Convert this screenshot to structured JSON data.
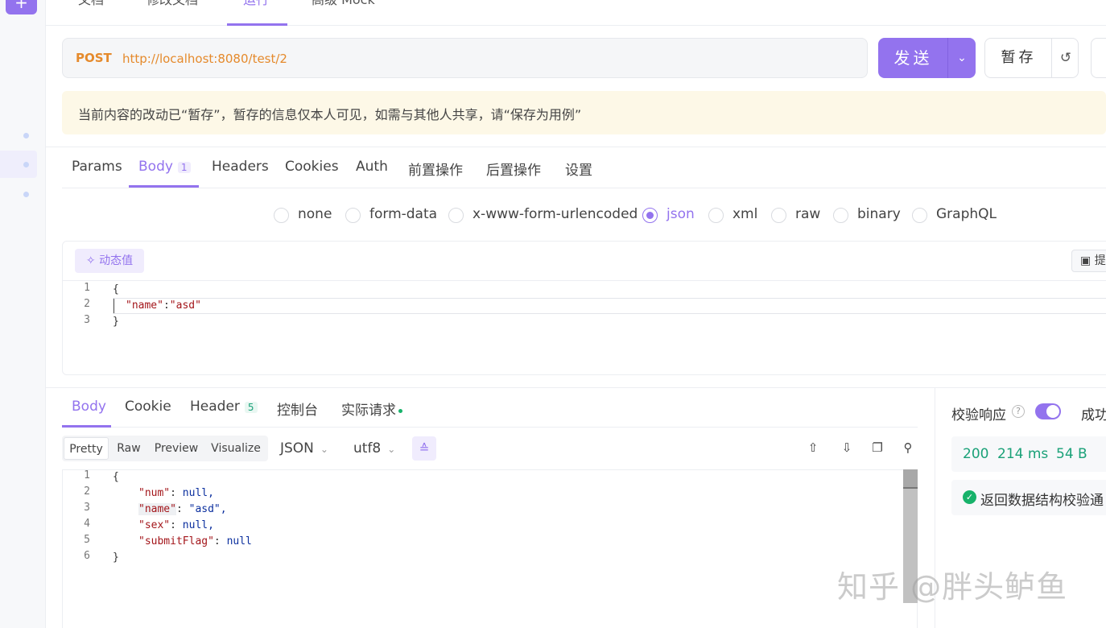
{
  "sidebar": {
    "add_icon": "plus-icon",
    "add_label": "+"
  },
  "top_tabs": [
    "文档",
    "修改文档",
    "运行",
    "高级 Mock"
  ],
  "request": {
    "method": "POST",
    "url": "http://localhost:8080/test/2",
    "send_label": "发送",
    "save_label": "暂存",
    "reset_icon": "reset-icon"
  },
  "notice": "当前内容的改动已“暂存”，暂存的信息仅本人可见，如需与其他人共享，请“保存为用例”",
  "request_tabs": {
    "params": "Params",
    "body": "Body",
    "body_badge": "1",
    "headers": "Headers",
    "cookies": "Cookies",
    "auth": "Auth",
    "pre": "前置操作",
    "post": "后置操作",
    "settings": "设置"
  },
  "body_types": [
    "none",
    "form-data",
    "x-www-form-urlencoded",
    "json",
    "xml",
    "raw",
    "binary",
    "GraphQL"
  ],
  "body_type_selected": "json",
  "editor": {
    "dynamic_label": "动态值",
    "extract_label": "提",
    "lines": [
      {
        "no": "1",
        "text": "{"
      },
      {
        "no": "2",
        "key": "\"name\"",
        "colon": ":",
        "value": "\"asd\""
      },
      {
        "no": "3",
        "text": "}"
      }
    ]
  },
  "response_tabs": {
    "body": "Body",
    "cookie": "Cookie",
    "header": "Header",
    "header_badge": "5",
    "console": "控制台",
    "actual": "实际请求"
  },
  "response_toolbar": {
    "formats": [
      "Pretty",
      "Raw",
      "Preview",
      "Visualize"
    ],
    "format_selected": "Pretty",
    "lang": "JSON",
    "encoding": "utf8"
  },
  "response_code": [
    {
      "no": "1",
      "text": "{"
    },
    {
      "no": "2",
      "key": "\"num\"",
      "value": "null,"
    },
    {
      "no": "3",
      "key": "\"name\"",
      "value": "\"asd\","
    },
    {
      "no": "4",
      "key": "\"sex\"",
      "value": "null,"
    },
    {
      "no": "5",
      "key": "\"submitFlag\"",
      "value": "null"
    },
    {
      "no": "6",
      "text": "}"
    }
  ],
  "right_panel": {
    "validate_label": "校验响应",
    "help": "?",
    "success_label": "成功",
    "status": "200",
    "time": "214 ms",
    "size": "54 B",
    "check_text": "返回数据结构校验通"
  },
  "watermark": "知乎 @胖头鲈鱼",
  "colors": {
    "accent": "#9373ee",
    "method": "#e58a2c",
    "success": "#1aa178"
  }
}
